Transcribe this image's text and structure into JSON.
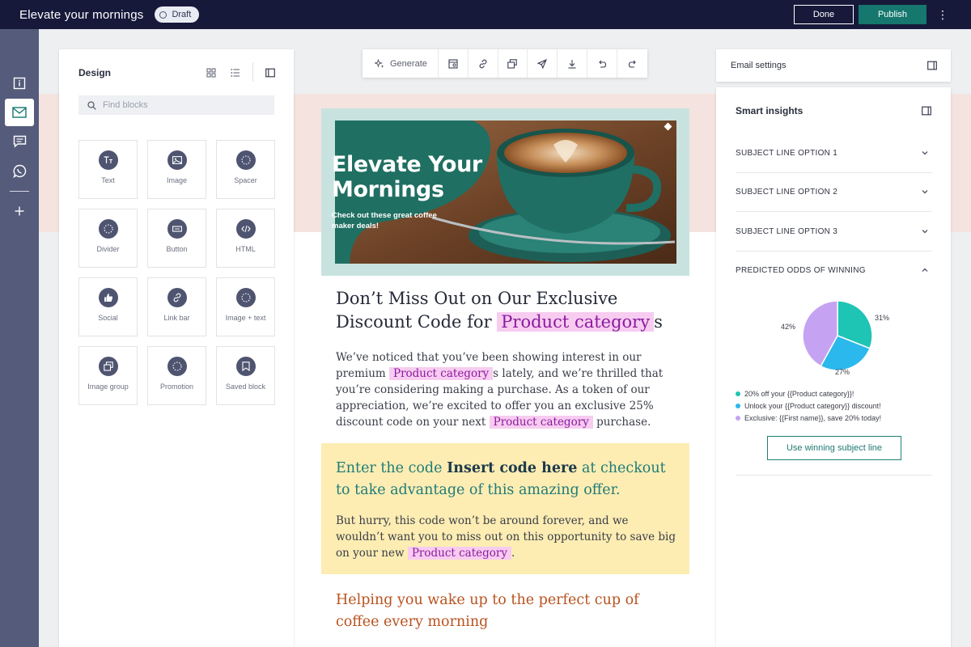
{
  "topbar": {
    "title": "Elevate your mornings",
    "status": "Draft",
    "done_label": "Done",
    "publish_label": "Publish",
    "more_icon": "⋮"
  },
  "rail": {
    "items": [
      "info-icon",
      "email-icon",
      "chat-icon",
      "whatsapp-icon",
      "plus-icon"
    ],
    "active": "email-icon"
  },
  "design_panel": {
    "title": "Design",
    "search_placeholder": "Find blocks",
    "blocks": [
      {
        "label": "Text",
        "icon": "text-icon"
      },
      {
        "label": "Image",
        "icon": "image-icon"
      },
      {
        "label": "Spacer",
        "icon": "spacer-icon"
      },
      {
        "label": "Divider",
        "icon": "divider-icon"
      },
      {
        "label": "Button",
        "icon": "button-icon"
      },
      {
        "label": "HTML",
        "icon": "code-icon"
      },
      {
        "label": "Social",
        "icon": "thumbs-up-icon"
      },
      {
        "label": "Link bar",
        "icon": "link-icon"
      },
      {
        "label": "Image + text",
        "icon": "image-text-icon"
      },
      {
        "label": "Image group",
        "icon": "image-group-icon"
      },
      {
        "label": "Promotion",
        "icon": "promotion-icon"
      },
      {
        "label": "Saved block",
        "icon": "bookmark-icon"
      }
    ]
  },
  "toolbar": {
    "generate_label": "Generate",
    "tools": [
      "preview-icon",
      "link-icon",
      "copy-icon",
      "send-icon",
      "download-icon",
      "undo-icon",
      "redo-icon"
    ]
  },
  "email": {
    "hero_title": "Elevate Your Mornings",
    "hero_subtitle": "Check out these great coffee maker deals!",
    "heading_part1": "Don’t Miss Out on Our Exclusive Discount Code for",
    "heading_token": "Product category",
    "heading_part2": "s",
    "body_part1": "We’ve noticed that you’ve been showing interest in our premium",
    "body_token1": "Product category",
    "body_part2": "s lately, and we’re thrilled that you’re considering making a purchase. As a token of our appreciation, we’re excited to offer you an exclusive 25% discount code on your next",
    "body_token2": "Product category",
    "body_part3": "purchase.",
    "promo_part1": "Enter the code",
    "promo_code": "Insert code here",
    "promo_part2": "at checkout to take advantage of this amazing offer.",
    "promo_body_part1": "But hurry, this code won’t be around forever, and we wouldn’t want you to miss out on this opportunity to save big on your new",
    "promo_token": "Product category",
    "promo_body_part2": ".",
    "closing_heading": "Helping you wake up to the perfect cup of coffee every morning"
  },
  "email_settings": {
    "label": "Email settings"
  },
  "insights": {
    "title": "Smart insights",
    "options": [
      {
        "label": "SUBJECT LINE OPTION 1",
        "expanded": false
      },
      {
        "label": "SUBJECT LINE OPTION 2",
        "expanded": false
      },
      {
        "label": "SUBJECT LINE OPTION 3",
        "expanded": false
      },
      {
        "label": "PREDICTED ODDS OF WINNING",
        "expanded": true
      }
    ],
    "cta_label": "Use winning subject line"
  },
  "chart_data": {
    "type": "pie",
    "series": [
      {
        "name": "20% off your {{Product category}}!",
        "value": 31,
        "label": "31%",
        "color": "#1ec4b4"
      },
      {
        "name": "Unlock your {{Product category}} discount!",
        "value": 27,
        "label": "27%",
        "color": "#2bb8ec"
      },
      {
        "name": "Exclusive: {{First name}}, save 20% today!",
        "value": 42,
        "label": "42%",
        "color": "#c5a3f2"
      }
    ]
  },
  "colors": {
    "topbar": "#16193a",
    "rail": "#555b7a",
    "accent": "#15776d",
    "token_bg": "#f7ccf0",
    "token_text": "#8c1aa0",
    "promo_bg": "#fdedb3"
  }
}
